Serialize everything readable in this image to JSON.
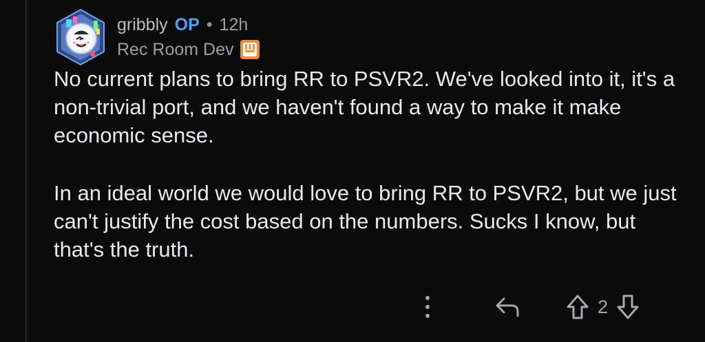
{
  "comment": {
    "username": "gribbly",
    "op_badge": "OP",
    "separator": "•",
    "time": "12h",
    "flair": "Rec Room Dev",
    "paragraphs": [
      "No current plans to bring RR to PSVR2. We've looked into it, it's a non-trivial port, and we haven't found a way to make it make economic sense.",
      "In an ideal world we would love to bring RR to PSVR2, but we just can't justify the cost based on the numbers. Sucks I know, but that's the truth."
    ],
    "vote_count": "2"
  },
  "colors": {
    "background": "#0b0b0c",
    "text": "#e8eaed",
    "op_accent": "#4aa3ff",
    "flair_accent": "#f28c38"
  },
  "icons": {
    "avatar": "astronaut-avatar-icon",
    "flair": "rec-room-icon",
    "more": "more-options-icon",
    "reply": "reply-icon",
    "upvote": "upvote-icon",
    "downvote": "downvote-icon"
  }
}
